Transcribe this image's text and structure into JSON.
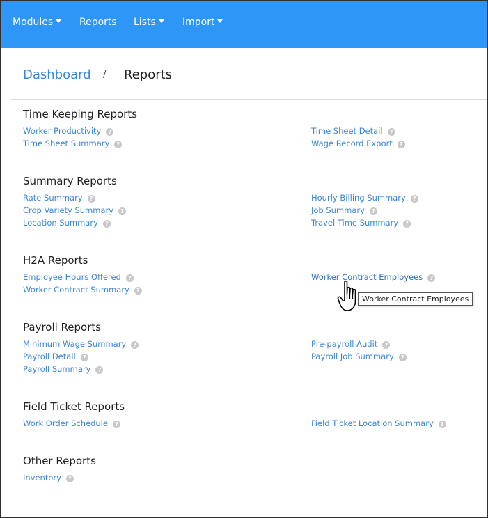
{
  "nav": {
    "modules": "Modules",
    "reports": "Reports",
    "lists": "Lists",
    "import": "Import"
  },
  "breadcrumb": {
    "home": "Dashboard",
    "separator": "/",
    "current": "Reports"
  },
  "sections": {
    "time_keeping": {
      "title": "Time Keeping Reports",
      "worker_productivity": "Worker Productivity",
      "time_sheet_summary": "Time Sheet Summary",
      "time_sheet_detail": "Time Sheet Detail",
      "wage_record_export": "Wage Record Export"
    },
    "summary": {
      "title": "Summary Reports",
      "rate_summary": "Rate Summary",
      "crop_variety_summary": "Crop Variety Summary",
      "location_summary": "Location Summary",
      "hourly_billing_summary": "Hourly Billing Summary",
      "job_summary": "Job Summary",
      "travel_time_summary": "Travel Time Summary"
    },
    "h2a": {
      "title": "H2A Reports",
      "employee_hours_offered": "Employee Hours Offered",
      "worker_contract_summary": "Worker Contract Summary",
      "worker_contract_employees": "Worker Contract Employees"
    },
    "payroll": {
      "title": "Payroll Reports",
      "minimum_wage_summary": "Minimum Wage Summary",
      "payroll_detail": "Payroll Detail",
      "payroll_summary": "Payroll Summary",
      "pre_payroll_audit": "Pre-payroll Audit",
      "payroll_job_summary": "Payroll Job Summary"
    },
    "field_ticket": {
      "title": "Field Ticket Reports",
      "work_order_schedule": "Work Order Schedule",
      "field_ticket_location_summary": "Field Ticket Location Summary"
    },
    "other": {
      "title": "Other Reports",
      "inventory": "Inventory"
    }
  },
  "help_glyph": "?",
  "tooltip": {
    "text": "Worker Contract Employees"
  },
  "colors": {
    "navbar": "#2d96f6",
    "link": "#3a86d9",
    "help_icon": "#c8c8c8"
  },
  "icons": {
    "help": "question-circle-icon",
    "dropdown": "caret-down-icon",
    "cursor": "hand-pointer-icon"
  }
}
